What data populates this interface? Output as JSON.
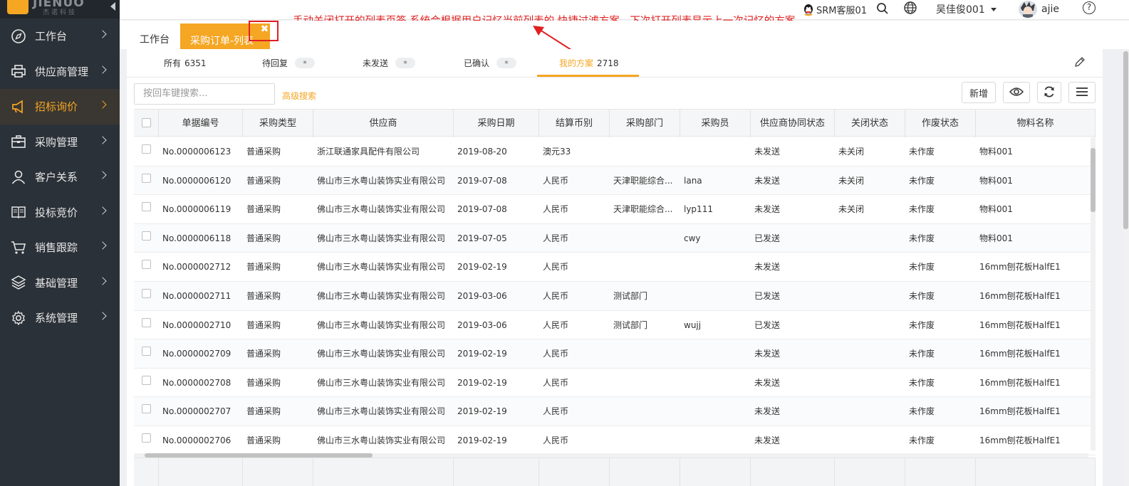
{
  "colors": {
    "accent": "#f5a623",
    "sidebar_bg": "#2b3138",
    "annotation": "#e02020"
  },
  "logo": {
    "text": "JIENUO",
    "sub": "杰诺科技"
  },
  "sidebar": {
    "items": [
      {
        "label": "工作台",
        "icon": "compass-icon"
      },
      {
        "label": "供应商管理",
        "icon": "printer-icon"
      },
      {
        "label": "招标询价",
        "icon": "megaphone-icon",
        "active": true
      },
      {
        "label": "采购管理",
        "icon": "briefcase-icon"
      },
      {
        "label": "客户关系",
        "icon": "user-icon"
      },
      {
        "label": "投标竞价",
        "icon": "book-icon"
      },
      {
        "label": "销售跟踪",
        "icon": "cart-icon"
      },
      {
        "label": "基础管理",
        "icon": "layers-icon"
      },
      {
        "label": "系统管理",
        "icon": "gear-icon"
      }
    ]
  },
  "topbar": {
    "annotation": "手动关闭打开的列表页签    系统会根据用户记忆当前列表的  快捷过滤方案，下次打开列表显示上一次记忆的方案",
    "service": "SRM客服01",
    "user_name": "吴佳俊001",
    "account": "ajie",
    "help": "?"
  },
  "tabs": {
    "home": "工作台",
    "active": "采购订单-列表",
    "close": "✖"
  },
  "filters": [
    {
      "label": "所有",
      "count": "6351"
    },
    {
      "label": "待回复",
      "badge": "*"
    },
    {
      "label": "未发送",
      "badge": "*"
    },
    {
      "label": "已确认",
      "badge": "*"
    },
    {
      "label": "我的方案",
      "count": "2718",
      "active": true
    }
  ],
  "toolbar": {
    "search_placeholder": "按回车键搜索...",
    "advanced": "高级搜索",
    "add": "新增"
  },
  "table": {
    "headers": [
      "单据编号",
      "采购类型",
      "供应商",
      "采购日期",
      "结算币别",
      "采购部门",
      "采购员",
      "供应商协同状态",
      "关闭状态",
      "作废状态",
      "物料名称"
    ],
    "rows": [
      [
        "No.0000006123",
        "普通采购",
        "浙江联通家具配件有限公司",
        "2019-08-20",
        "澳元33",
        "",
        "",
        "未发送",
        "未关闭",
        "未作废",
        "物料001"
      ],
      [
        "No.0000006120",
        "普通采购",
        "佛山市三水粤山装饰实业有限公司",
        "2019-07-08",
        "人民币",
        "天津职能综合...",
        "lana",
        "未发送",
        "未关闭",
        "未作废",
        "物料001"
      ],
      [
        "No.0000006119",
        "普通采购",
        "佛山市三水粤山装饰实业有限公司",
        "2019-07-08",
        "人民币",
        "天津职能综合...",
        "lyp111",
        "未发送",
        "未关闭",
        "未作废",
        "物料001"
      ],
      [
        "No.0000006118",
        "普通采购",
        "佛山市三水粤山装饰实业有限公司",
        "2019-07-05",
        "人民币",
        "",
        "cwy",
        "已发送",
        "",
        "未作废",
        "物料001"
      ],
      [
        "No.0000002712",
        "普通采购",
        "佛山市三水粤山装饰实业有限公司",
        "2019-02-19",
        "人民币",
        "",
        "",
        "未发送",
        "",
        "未作废",
        "16mm刨花板HalfE1"
      ],
      [
        "No.0000002711",
        "普通采购",
        "佛山市三水粤山装饰实业有限公司",
        "2019-03-06",
        "人民币",
        "测试部门",
        "",
        "已发送",
        "",
        "未作废",
        "16mm刨花板HalfE1"
      ],
      [
        "No.0000002710",
        "普通采购",
        "佛山市三水粤山装饰实业有限公司",
        "2019-03-06",
        "人民币",
        "测试部门",
        "wujj",
        "已发送",
        "",
        "未作废",
        "16mm刨花板HalfE1"
      ],
      [
        "No.0000002709",
        "普通采购",
        "佛山市三水粤山装饰实业有限公司",
        "2019-02-19",
        "人民币",
        "",
        "",
        "未发送",
        "",
        "未作废",
        "16mm刨花板HalfE1"
      ],
      [
        "No.0000002708",
        "普通采购",
        "佛山市三水粤山装饰实业有限公司",
        "2019-02-19",
        "人民币",
        "",
        "",
        "未发送",
        "",
        "未作废",
        "16mm刨花板HalfE1"
      ],
      [
        "No.0000002707",
        "普通采购",
        "佛山市三水粤山装饰实业有限公司",
        "2019-02-19",
        "人民币",
        "",
        "",
        "未发送",
        "",
        "未作废",
        "16mm刨花板HalfE1"
      ],
      [
        "No.0000002706",
        "普通采购",
        "佛山市三水粤山装饰实业有限公司",
        "2019-02-19",
        "人民币",
        "",
        "",
        "未发送",
        "",
        "未作废",
        "16mm刨花板HalfE1"
      ]
    ]
  }
}
